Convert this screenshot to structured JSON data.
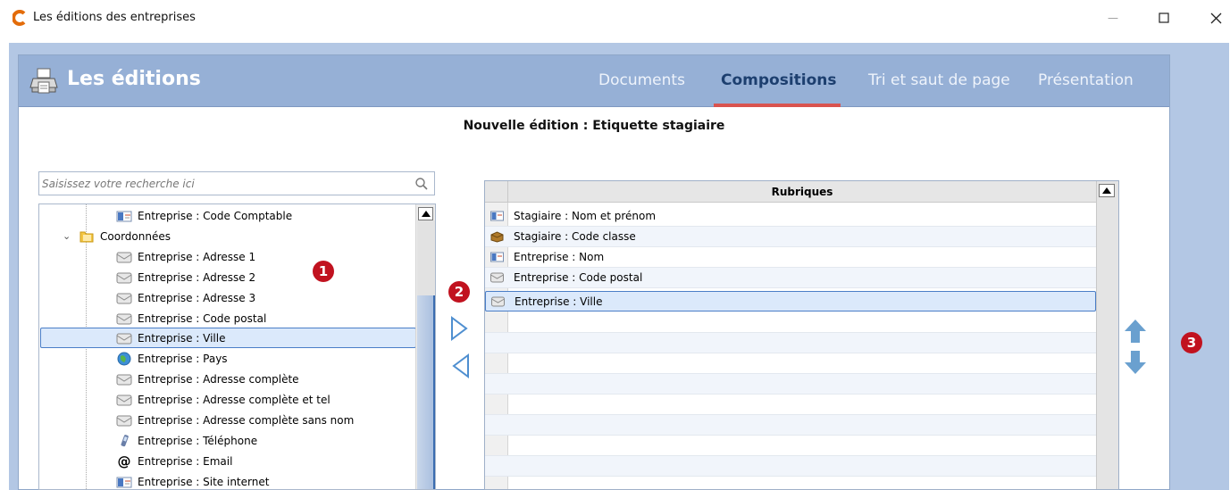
{
  "window": {
    "title": "Les éditions des entreprises",
    "minimize_glyph": "—",
    "maximize_glyph": "☐",
    "close_glyph": "✕"
  },
  "header": {
    "title": "Les éditions",
    "tabs": [
      {
        "label": "Documents",
        "active": false
      },
      {
        "label": "Compositions",
        "active": true
      },
      {
        "label": "Tri et saut de page",
        "active": false
      },
      {
        "label": "Présentation",
        "active": false
      }
    ],
    "accent_color": "#d9534f"
  },
  "edition_title": "Nouvelle édition : Etiquette stagiaire",
  "search": {
    "placeholder": "Saisissez votre recherche ici",
    "value": ""
  },
  "tree": {
    "items": [
      {
        "label": "Entreprise : Code Comptable",
        "icon": "id-card-icon"
      },
      {
        "label": "Coordonnées",
        "icon": "folder-icon",
        "expanded": true
      },
      {
        "label": "Entreprise : Adresse 1",
        "icon": "envelope-icon"
      },
      {
        "label": "Entreprise : Adresse 2",
        "icon": "envelope-icon"
      },
      {
        "label": "Entreprise : Adresse 3",
        "icon": "envelope-icon"
      },
      {
        "label": "Entreprise : Code postal",
        "icon": "envelope-icon"
      },
      {
        "label": "Entreprise : Ville",
        "icon": "envelope-icon",
        "selected": true
      },
      {
        "label": "Entreprise : Pays",
        "icon": "globe-icon"
      },
      {
        "label": "Entreprise : Adresse complète",
        "icon": "envelope-icon"
      },
      {
        "label": "Entreprise : Adresse complète et tel",
        "icon": "envelope-icon"
      },
      {
        "label": "Entreprise : Adresse complète sans nom",
        "icon": "envelope-icon"
      },
      {
        "label": "Entreprise : Téléphone",
        "icon": "phone-icon"
      },
      {
        "label": "Entreprise : Email",
        "icon": "at-sign-icon"
      },
      {
        "label": "Entreprise : Site internet",
        "icon": "id-card-icon"
      }
    ]
  },
  "badges": [
    "1",
    "2",
    "3"
  ],
  "grid": {
    "header": "Rubriques",
    "rows": [
      {
        "label": "Stagiaire : Nom et prénom",
        "icon": "id-card-icon"
      },
      {
        "label": "Stagiaire : Code classe",
        "icon": "box-icon"
      },
      {
        "label": "Entreprise : Nom",
        "icon": "id-card-icon"
      },
      {
        "label": "Entreprise : Code postal",
        "icon": "envelope-icon"
      },
      {
        "label": "Entreprise : Ville",
        "icon": "envelope-icon",
        "selected": true
      }
    ]
  },
  "colors": {
    "frame": "#b3c7e4",
    "header": "#96b0d6",
    "active_tab": "#1d3f6f",
    "badge": "#c1121f",
    "arrows": "#5b9bd5",
    "selection_border": "#4a7ec7"
  }
}
